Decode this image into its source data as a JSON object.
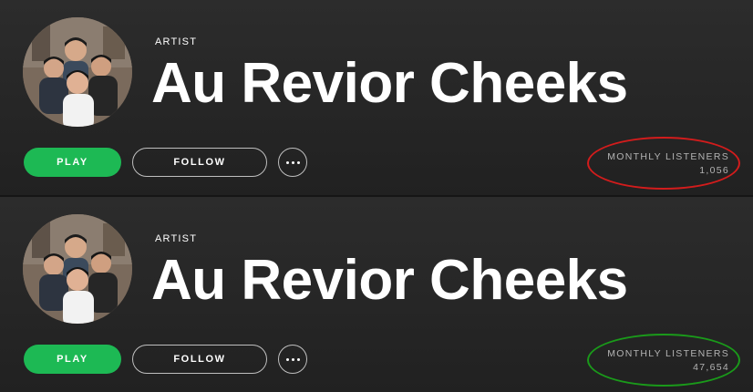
{
  "panels": [
    {
      "label": "ARTIST",
      "artist_name": "Au Revior Cheeks",
      "play_label": "PLAY",
      "follow_label": "FOLLOW",
      "listeners_label": "MONTHLY LISTENERS",
      "listeners_count": "1,056",
      "highlight_color": "#d31c1c"
    },
    {
      "label": "ARTIST",
      "artist_name": "Au Revior Cheeks",
      "play_label": "PLAY",
      "follow_label": "FOLLOW",
      "listeners_label": "MONTHLY LISTENERS",
      "listeners_count": "47,654",
      "highlight_color": "#1a9a1a"
    }
  ],
  "colors": {
    "play_button": "#1db954",
    "background": "#282828",
    "text_primary": "#ffffff",
    "text_secondary": "#b3b3b3"
  },
  "icons": {
    "more": "more-options-icon"
  }
}
